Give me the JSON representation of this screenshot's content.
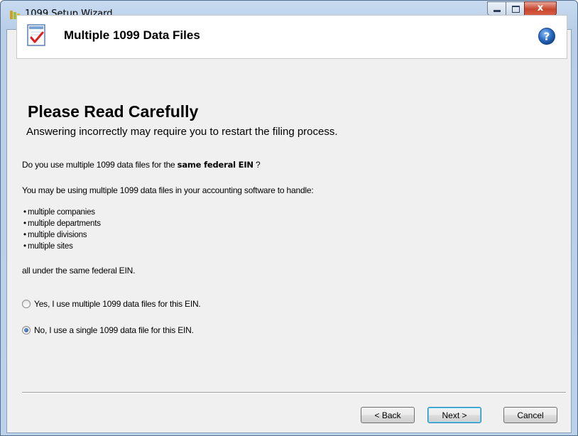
{
  "window": {
    "title": "1099 Setup Wizard",
    "controls": {
      "minimize": "minimize",
      "maximize": "maximize",
      "close": "x"
    }
  },
  "header": {
    "title": "Multiple 1099 Data Files",
    "icon": "checklist-icon",
    "help_icon": "help-icon"
  },
  "content": {
    "heading": "Please Read Carefully",
    "subheading": "Answering incorrectly may require you to restart the filing process.",
    "question_prefix": "Do you use multiple 1099 data files for the ",
    "question_bold": "same federal EIN",
    "question_suffix": " ?",
    "info": "You may be using multiple 1099 data files in your accounting software to handle:",
    "bullets": [
      "multiple companies",
      "multiple departments",
      "multiple divisions",
      "multiple sites"
    ],
    "all_under": "all under the same federal EIN."
  },
  "options": [
    {
      "label": "Yes, I use multiple 1099 data files for this EIN.",
      "checked": false
    },
    {
      "label": "No, I use a single 1099 data file for this EIN.",
      "checked": true
    }
  ],
  "buttons": {
    "back": "< Back",
    "next": "Next >",
    "cancel": "Cancel"
  },
  "colors": {
    "titlebar": "#c7daf0",
    "client": "#f0f0f0",
    "help": "#2b6cc4",
    "check": "#e02020"
  }
}
